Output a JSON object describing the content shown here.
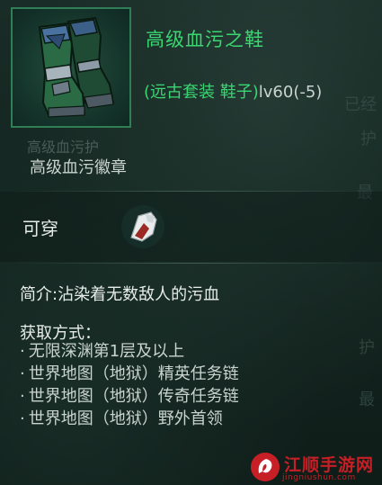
{
  "item": {
    "name": "高级血污之鞋",
    "subtitle_prefix": "(远古套装 鞋子)",
    "level_text": "lv60(-5)",
    "icon": "green-boots-icon"
  },
  "set": {
    "faded_line": "高级血污护",
    "name": "高级血污徽章"
  },
  "wear": {
    "label": "可穿",
    "icon": "equip-hand-icon"
  },
  "description": "简介:沾染着无数敌人的污血",
  "obtain": {
    "title": "获取方式：",
    "items": [
      "无限深渊第1层及以上",
      "世界地图（地狱）精英任务链",
      "世界地图（地狱）传奇任务链",
      "世界地图（地狱）野外首领"
    ]
  },
  "background_ghost_text": [
    "已经",
    "护",
    "最",
    "护",
    "最"
  ],
  "watermark": {
    "text": "江顺手游网",
    "url": "jingniushun.com"
  },
  "colors": {
    "accent_green": "#39d671",
    "text": "#c9d3cf",
    "watermark_red": "#c71f26"
  }
}
